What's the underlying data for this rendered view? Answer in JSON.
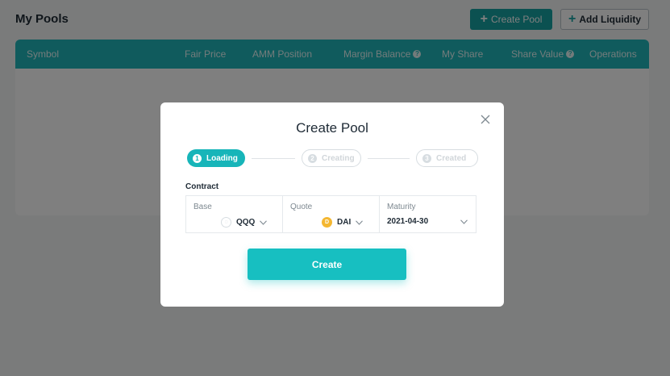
{
  "page": {
    "title": "My Pools",
    "create_pool_label": "Create Pool",
    "add_liquidity_label": "Add Liquidity"
  },
  "table": {
    "columns": [
      "Symbol",
      "Fair Price",
      "AMM Position",
      "Margin Balance",
      "My Share",
      "Share Value",
      "Operations"
    ],
    "help_icon_glyph": "?"
  },
  "modal": {
    "title": "Create Pool",
    "steps": [
      {
        "num": "1",
        "label": "Loading",
        "state": "active"
      },
      {
        "num": "2",
        "label": "Creating",
        "state": "inactive"
      },
      {
        "num": "3",
        "label": "Created",
        "state": "inactive"
      }
    ],
    "contract_label": "Contract",
    "base": {
      "label": "Base",
      "value": "QQQ",
      "icon": "qqq-token-icon"
    },
    "quote": {
      "label": "Quote",
      "value": "DAI",
      "icon": "dai-token-icon",
      "icon_glyph": "D"
    },
    "maturity": {
      "label": "Maturity",
      "value": "2021-04-30"
    },
    "create_label": "Create"
  },
  "colors": {
    "accent": "#17a2a2",
    "table_header": "#20b7bb",
    "create_button": "#17bfc1",
    "dai": "#f4b731"
  }
}
